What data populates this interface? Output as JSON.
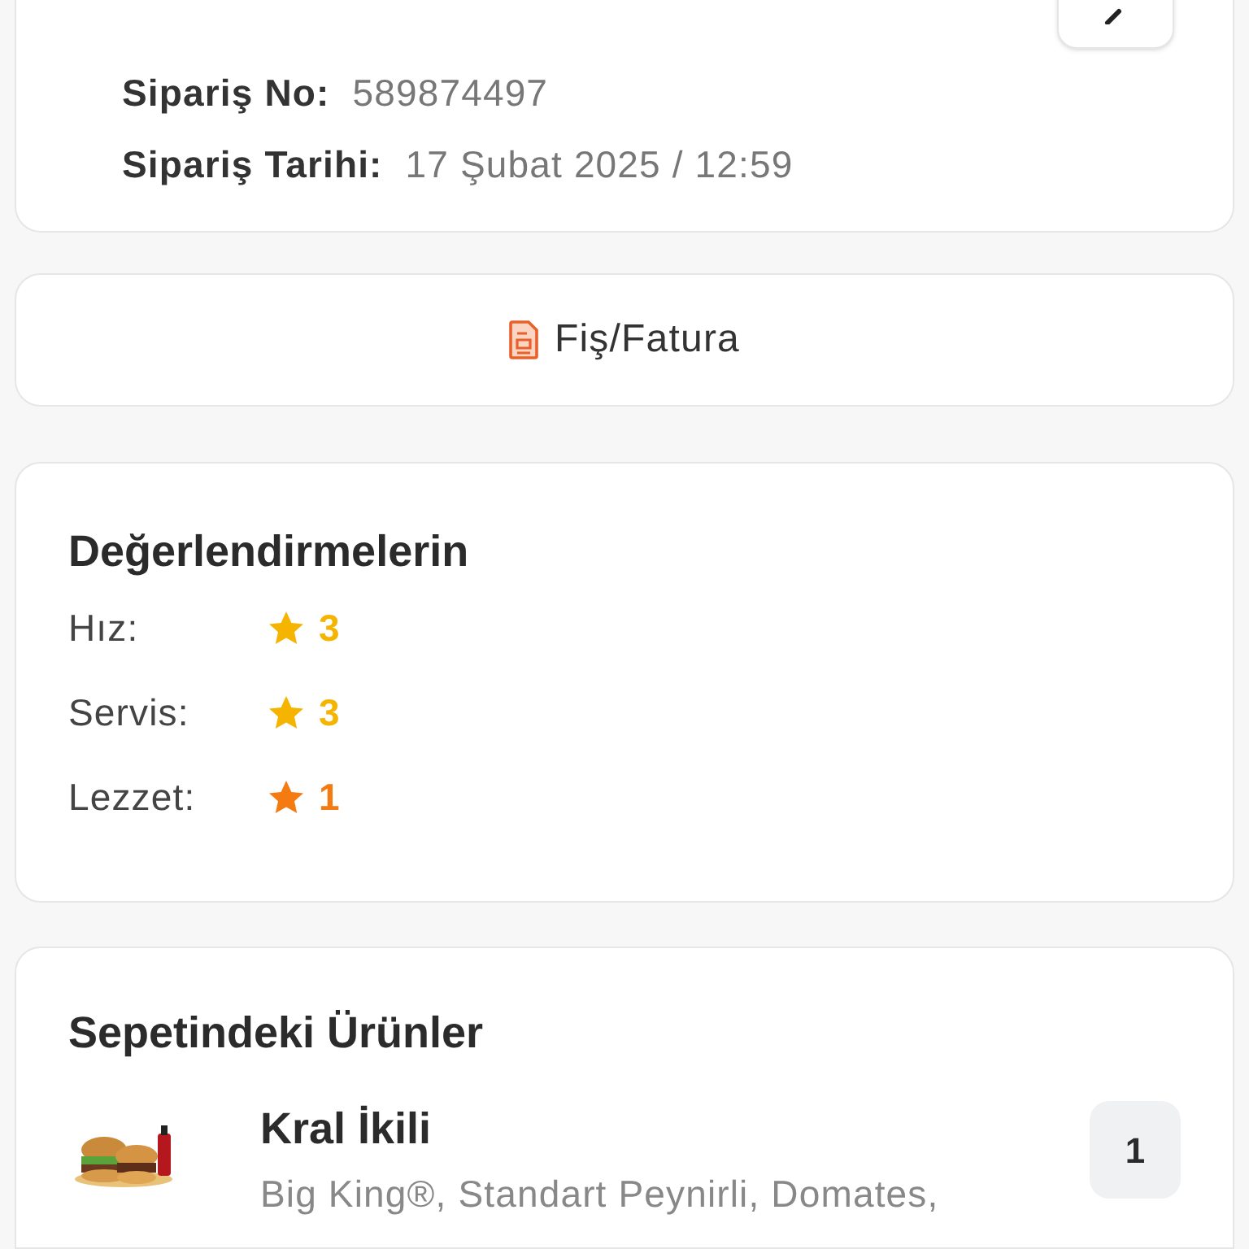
{
  "order": {
    "fields": [
      {
        "label": "Sipariş No:",
        "value": "589874497"
      },
      {
        "label": "Sipariş Tarihi:",
        "value": "17 Şubat 2025 / 12:59"
      }
    ]
  },
  "receipt_button": {
    "label": "Fiş/Fatura"
  },
  "ratings": {
    "title": "Değerlendirmelerin",
    "items": [
      {
        "label": "Hız:",
        "score": "3",
        "color": "#f5b400"
      },
      {
        "label": "Servis:",
        "score": "3",
        "color": "#f5b400"
      },
      {
        "label": "Lezzet:",
        "score": "1",
        "color": "#f47a12"
      }
    ]
  },
  "basket": {
    "title": "Sepetindeki Ürünler",
    "items": [
      {
        "name": "Kral İkili",
        "description": "Big King®, Standart Peynirli, Domates,",
        "quantity": "1"
      }
    ]
  }
}
